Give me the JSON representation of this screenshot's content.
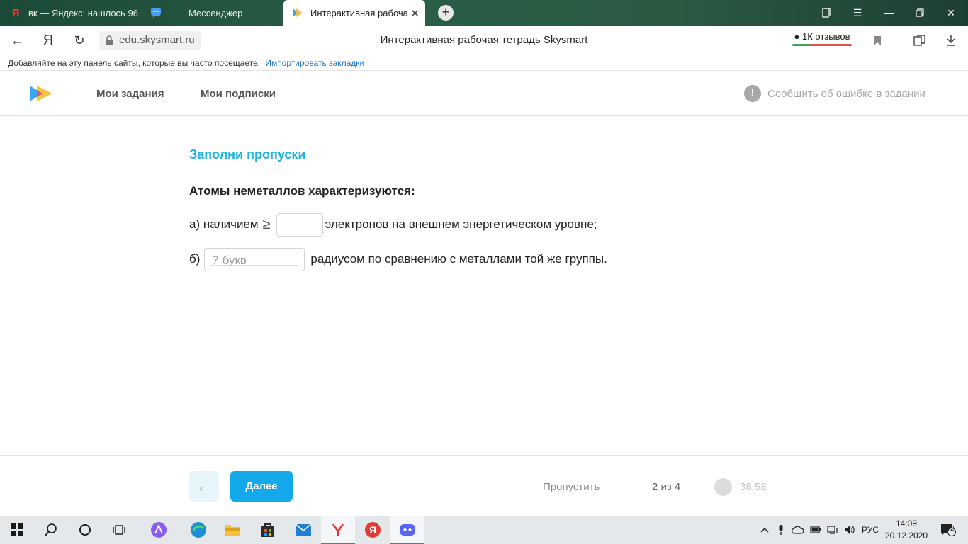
{
  "browser": {
    "tabs": [
      {
        "label": "вк — Яндекс: нашлось 96"
      },
      {
        "label": "Мессенджер"
      },
      {
        "label": "Интерактивная рабоча"
      }
    ],
    "url": "edu.skysmart.ru",
    "page_title": "Интерактивная рабочая тетрадь Skysmart",
    "reviews": "1К отзывов",
    "bookmarks_text": "Добавляйте на эту панель сайты, которые вы часто посещаете.",
    "bookmarks_link": "Импортировать закладки"
  },
  "site": {
    "nav": [
      "Мои задания",
      "Мои подписки"
    ],
    "report": "Сообщить об ошибке в задании"
  },
  "task": {
    "title": "Заполни пропуски",
    "question": "Атомы неметаллов характеризуются:",
    "line_a_prefix": "а) наличием",
    "geq": "≥",
    "line_a_suffix": "электронов на внешнем энергетическом уровне;",
    "line_b_prefix": "б)",
    "blank_b_placeholder": "7 букв",
    "line_b_suffix": "радиусом по сравнению с металлами той же группы."
  },
  "footer": {
    "next": "Далее",
    "skip": "Пропустить",
    "progress": "2 из 4",
    "timer": "38:58"
  },
  "taskbar": {
    "lang": "РУС",
    "time": "14:09",
    "date": "20.12.2020",
    "notifications": "2"
  },
  "colors": {
    "accent": "#14a9ea",
    "title_blue": "#1ab3e6",
    "tabstrip": "#2a5e46"
  }
}
